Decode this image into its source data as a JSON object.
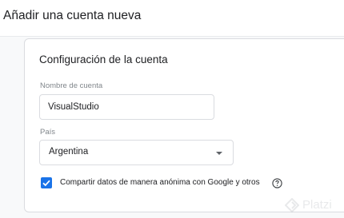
{
  "page": {
    "title": "Añadir una cuenta nueva"
  },
  "section": {
    "title": "Configuración de la cuenta"
  },
  "account_name": {
    "label": "Nombre de cuenta",
    "value": "VisualStudio"
  },
  "country": {
    "label": "País",
    "selected": "Argentina",
    "icon": "arrow-drop-down-icon"
  },
  "data_sharing": {
    "label": "Compartir datos de manera anónima con Google y otros",
    "checked": true,
    "help_icon": "help-circle-icon"
  },
  "watermark": {
    "text": "Platzi",
    "icon": "platzi-logo-icon"
  },
  "colors": {
    "accent": "#1a73e8",
    "border": "#dadce0",
    "muted_text": "#80868b",
    "background_panel": "#f8f9fa"
  }
}
